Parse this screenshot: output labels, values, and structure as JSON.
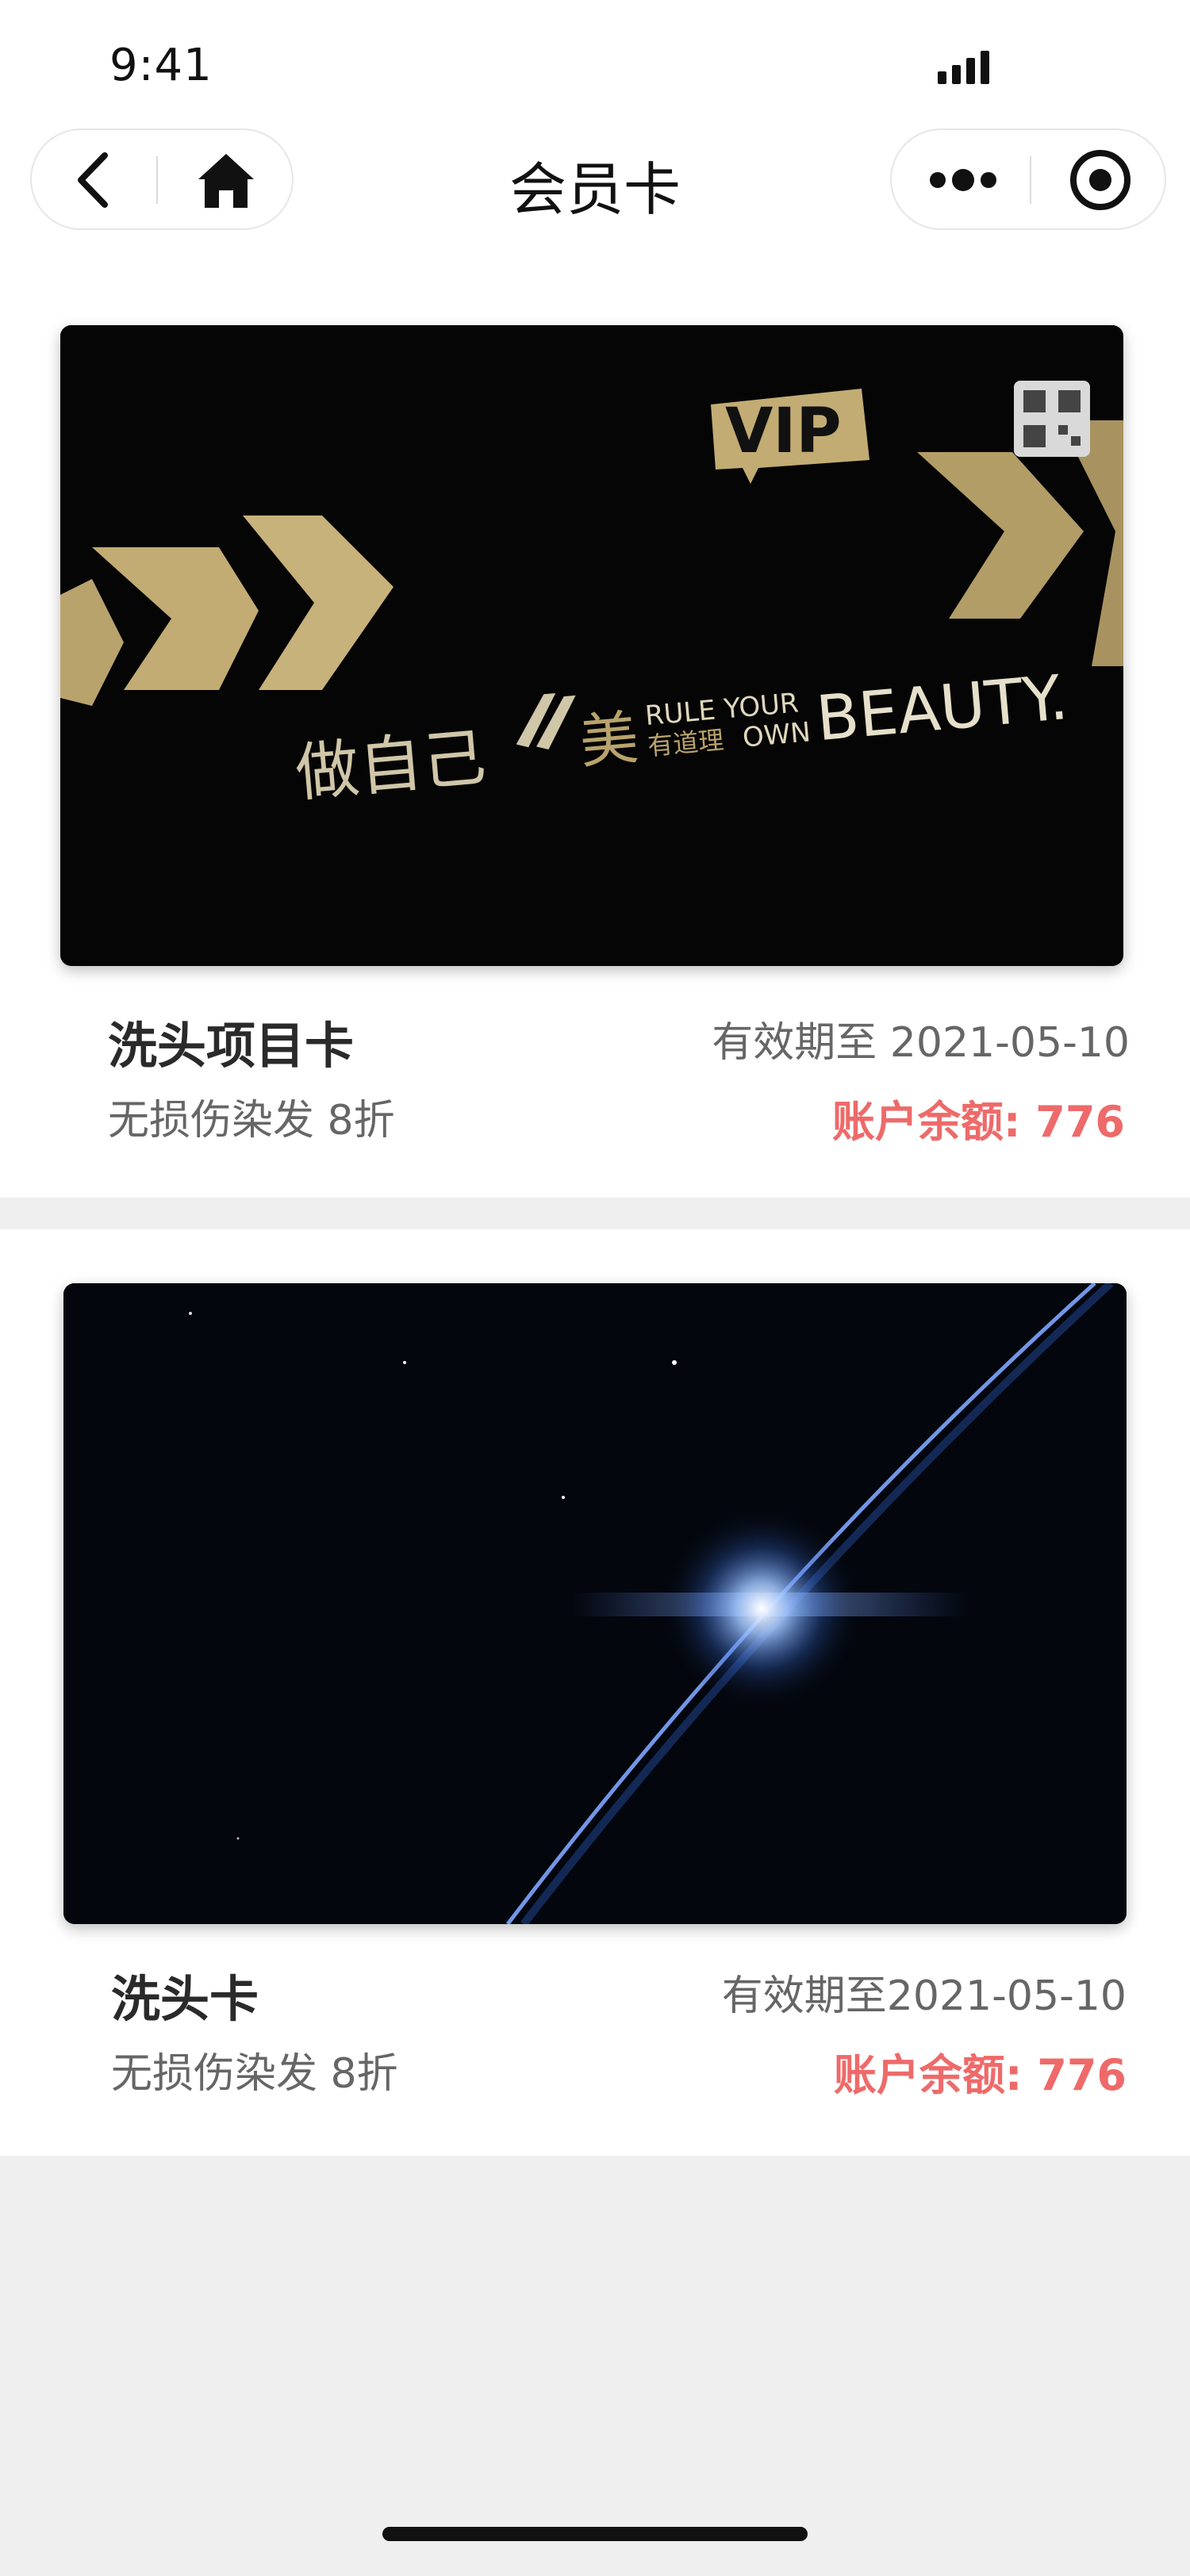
{
  "status_bar": {
    "time": "9:41"
  },
  "nav": {
    "title": "会员卡",
    "back_icon": "chevron-left-icon",
    "home_icon": "home-icon",
    "more_icon": "more-dots-icon",
    "close_icon": "target-circle-icon"
  },
  "cards": [
    {
      "name": "洗头项目卡",
      "description": "无损伤染发 8折",
      "expiry": "有效期至 2021-05-10",
      "balance": "账户余额: 776",
      "image": {
        "vip_badge": "VIP",
        "slogan_cn_1": "做自己",
        "slogan_cn_2": "美",
        "slogan_cn_3": "有道理",
        "slogan_en_1": "RULE YOUR",
        "slogan_en_2": "OWN",
        "slogan_en_3": "BEAUTY."
      }
    },
    {
      "name": "洗头卡",
      "description": "无损伤染发 8折",
      "expiry": "有效期至2021-05-10",
      "balance": "账户余额: 776"
    }
  ],
  "colors": {
    "accent_balance": "#ee6a6a",
    "page_background": "#efefef",
    "card_gold": "#c9b27a"
  }
}
